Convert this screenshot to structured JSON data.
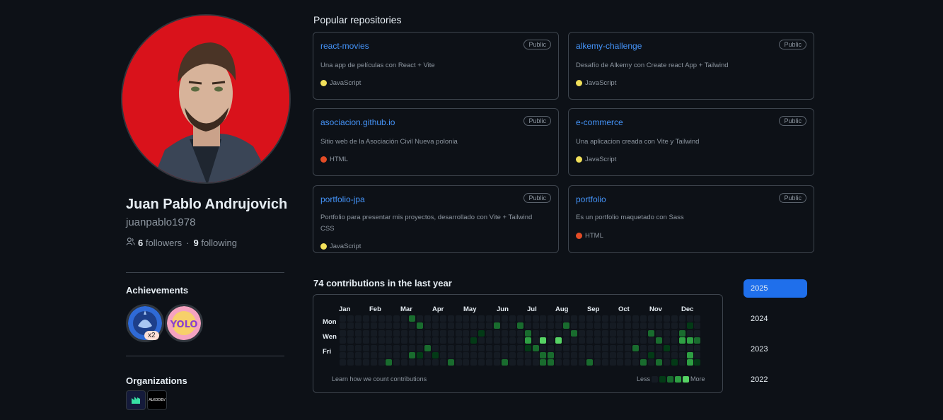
{
  "profile": {
    "fullname": "Juan Pablo Andrujovich",
    "login": "juanpablo1978",
    "followers_count": "6",
    "followers_label": "followers",
    "separator": "·",
    "following_count": "9",
    "following_label": "following",
    "avatar_bg": "#d9121b"
  },
  "achievements": {
    "title": "Achievements",
    "badges": [
      {
        "icon": "pull-shark-badge-icon",
        "count": "x2"
      },
      {
        "icon": "yolo-badge-icon",
        "text": "YOLO"
      }
    ]
  },
  "organizations": {
    "title": "Organizations",
    "items": [
      {
        "icon": "org-alkemy-logo-icon"
      },
      {
        "icon": "org-text-logo-icon",
        "text": "ALKODEV"
      }
    ]
  },
  "repos": {
    "title": "Popular repositories",
    "items": [
      {
        "name": "react-movies",
        "visibility": "Public",
        "description": "Una app de películas con React + Vite",
        "language": "JavaScript",
        "lang_color": "#f1e05a"
      },
      {
        "name": "alkemy-challenge",
        "visibility": "Public",
        "description": "Desafío de Alkemy con Create react App + Tailwind",
        "language": "JavaScript",
        "lang_color": "#f1e05a"
      },
      {
        "name": "asociacion.github.io",
        "visibility": "Public",
        "description": "Sitio web de la Asociación Civil Nueva polonia",
        "language": "HTML",
        "lang_color": "#e34c26"
      },
      {
        "name": "e-commerce",
        "visibility": "Public",
        "description": "Una aplicacion creada con Vite y Tailwind",
        "language": "JavaScript",
        "lang_color": "#f1e05a"
      },
      {
        "name": "portfolio-jpa",
        "visibility": "Public",
        "description": "Portfolio para presentar mis proyectos, desarrollado con Vite + Tailwind CSS",
        "language": "JavaScript",
        "lang_color": "#f1e05a"
      },
      {
        "name": "portfolio",
        "visibility": "Public",
        "description": "Es un portfolio maquetado con Sass",
        "language": "HTML",
        "lang_color": "#e34c26"
      }
    ]
  },
  "contributions": {
    "title": "74 contributions in the last year",
    "months": [
      "Jan",
      "Feb",
      "Mar",
      "Apr",
      "May",
      "Jun",
      "Jul",
      "Aug",
      "Sep",
      "Oct",
      "Nov",
      "Dec"
    ],
    "day_labels": [
      "Mon",
      "Wen",
      "Fri"
    ],
    "learn_link": "Learn how we count contributions",
    "legend_less": "Less",
    "legend_more": "More",
    "colors": [
      "#151b23",
      "#033a16",
      "#196c2e",
      "#2ea043",
      "#56d364"
    ],
    "weeks": 47,
    "active_cells": [
      [
        6,
        6,
        2
      ],
      [
        9,
        5,
        2
      ],
      [
        9,
        0,
        2
      ],
      [
        10,
        5,
        1
      ],
      [
        10,
        1,
        2
      ],
      [
        11,
        4,
        2
      ],
      [
        12,
        5,
        1
      ],
      [
        14,
        6,
        2
      ],
      [
        17,
        3,
        1
      ],
      [
        18,
        2,
        1
      ],
      [
        20,
        1,
        2
      ],
      [
        21,
        6,
        2
      ],
      [
        23,
        1,
        2
      ],
      [
        24,
        2,
        2
      ],
      [
        24,
        3,
        3
      ],
      [
        24,
        4,
        1
      ],
      [
        25,
        4,
        2
      ],
      [
        26,
        3,
        4
      ],
      [
        26,
        5,
        2
      ],
      [
        26,
        6,
        2
      ],
      [
        27,
        5,
        2
      ],
      [
        27,
        6,
        2
      ],
      [
        28,
        3,
        4
      ],
      [
        29,
        1,
        2
      ],
      [
        30,
        2,
        2
      ],
      [
        32,
        6,
        2
      ],
      [
        38,
        4,
        2
      ],
      [
        39,
        6,
        2
      ],
      [
        40,
        2,
        2
      ],
      [
        40,
        5,
        1
      ],
      [
        41,
        3,
        2
      ],
      [
        41,
        6,
        2
      ],
      [
        42,
        4,
        1
      ],
      [
        43,
        6,
        1
      ],
      [
        44,
        2,
        2
      ],
      [
        44,
        3,
        3
      ],
      [
        45,
        1,
        1
      ],
      [
        45,
        3,
        3
      ],
      [
        45,
        5,
        3
      ],
      [
        45,
        6,
        3
      ],
      [
        46,
        3,
        2
      ],
      [
        46,
        6,
        1
      ],
      [
        47,
        3,
        2
      ]
    ]
  },
  "years": {
    "items": [
      "2025",
      "2024",
      "2023",
      "2022"
    ],
    "active": "2025",
    "active_color": "#1f6feb"
  }
}
